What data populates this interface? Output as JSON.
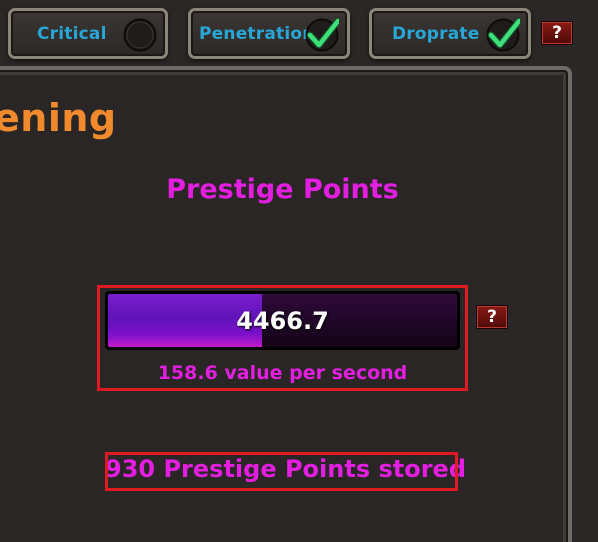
{
  "toggles": [
    {
      "label": "Critical",
      "checked": false
    },
    {
      "label": "Penetration",
      "checked": true
    },
    {
      "label": "Droprate",
      "checked": true
    }
  ],
  "help_label": "?",
  "panel": {
    "title": "ening",
    "heading": "Prestige Points",
    "bar": {
      "value_text": "4466.7",
      "fill_fraction": 0.44,
      "rate_text": "158.6 value per second"
    },
    "stored_text": "930 Prestige Points stored"
  },
  "colors": {
    "accent_magenta": "#e41ee0",
    "title_orange": "#f08a2d",
    "toggle_label_blue": "#28a7d6",
    "check_green": "#3fe07a",
    "highlight_red": "#e01a22",
    "bar_purple": "#6a14c0"
  },
  "icons": {
    "unchecked": "empty-circle-icon",
    "checked": "checkmark-icon",
    "help": "question-mark-icon"
  }
}
